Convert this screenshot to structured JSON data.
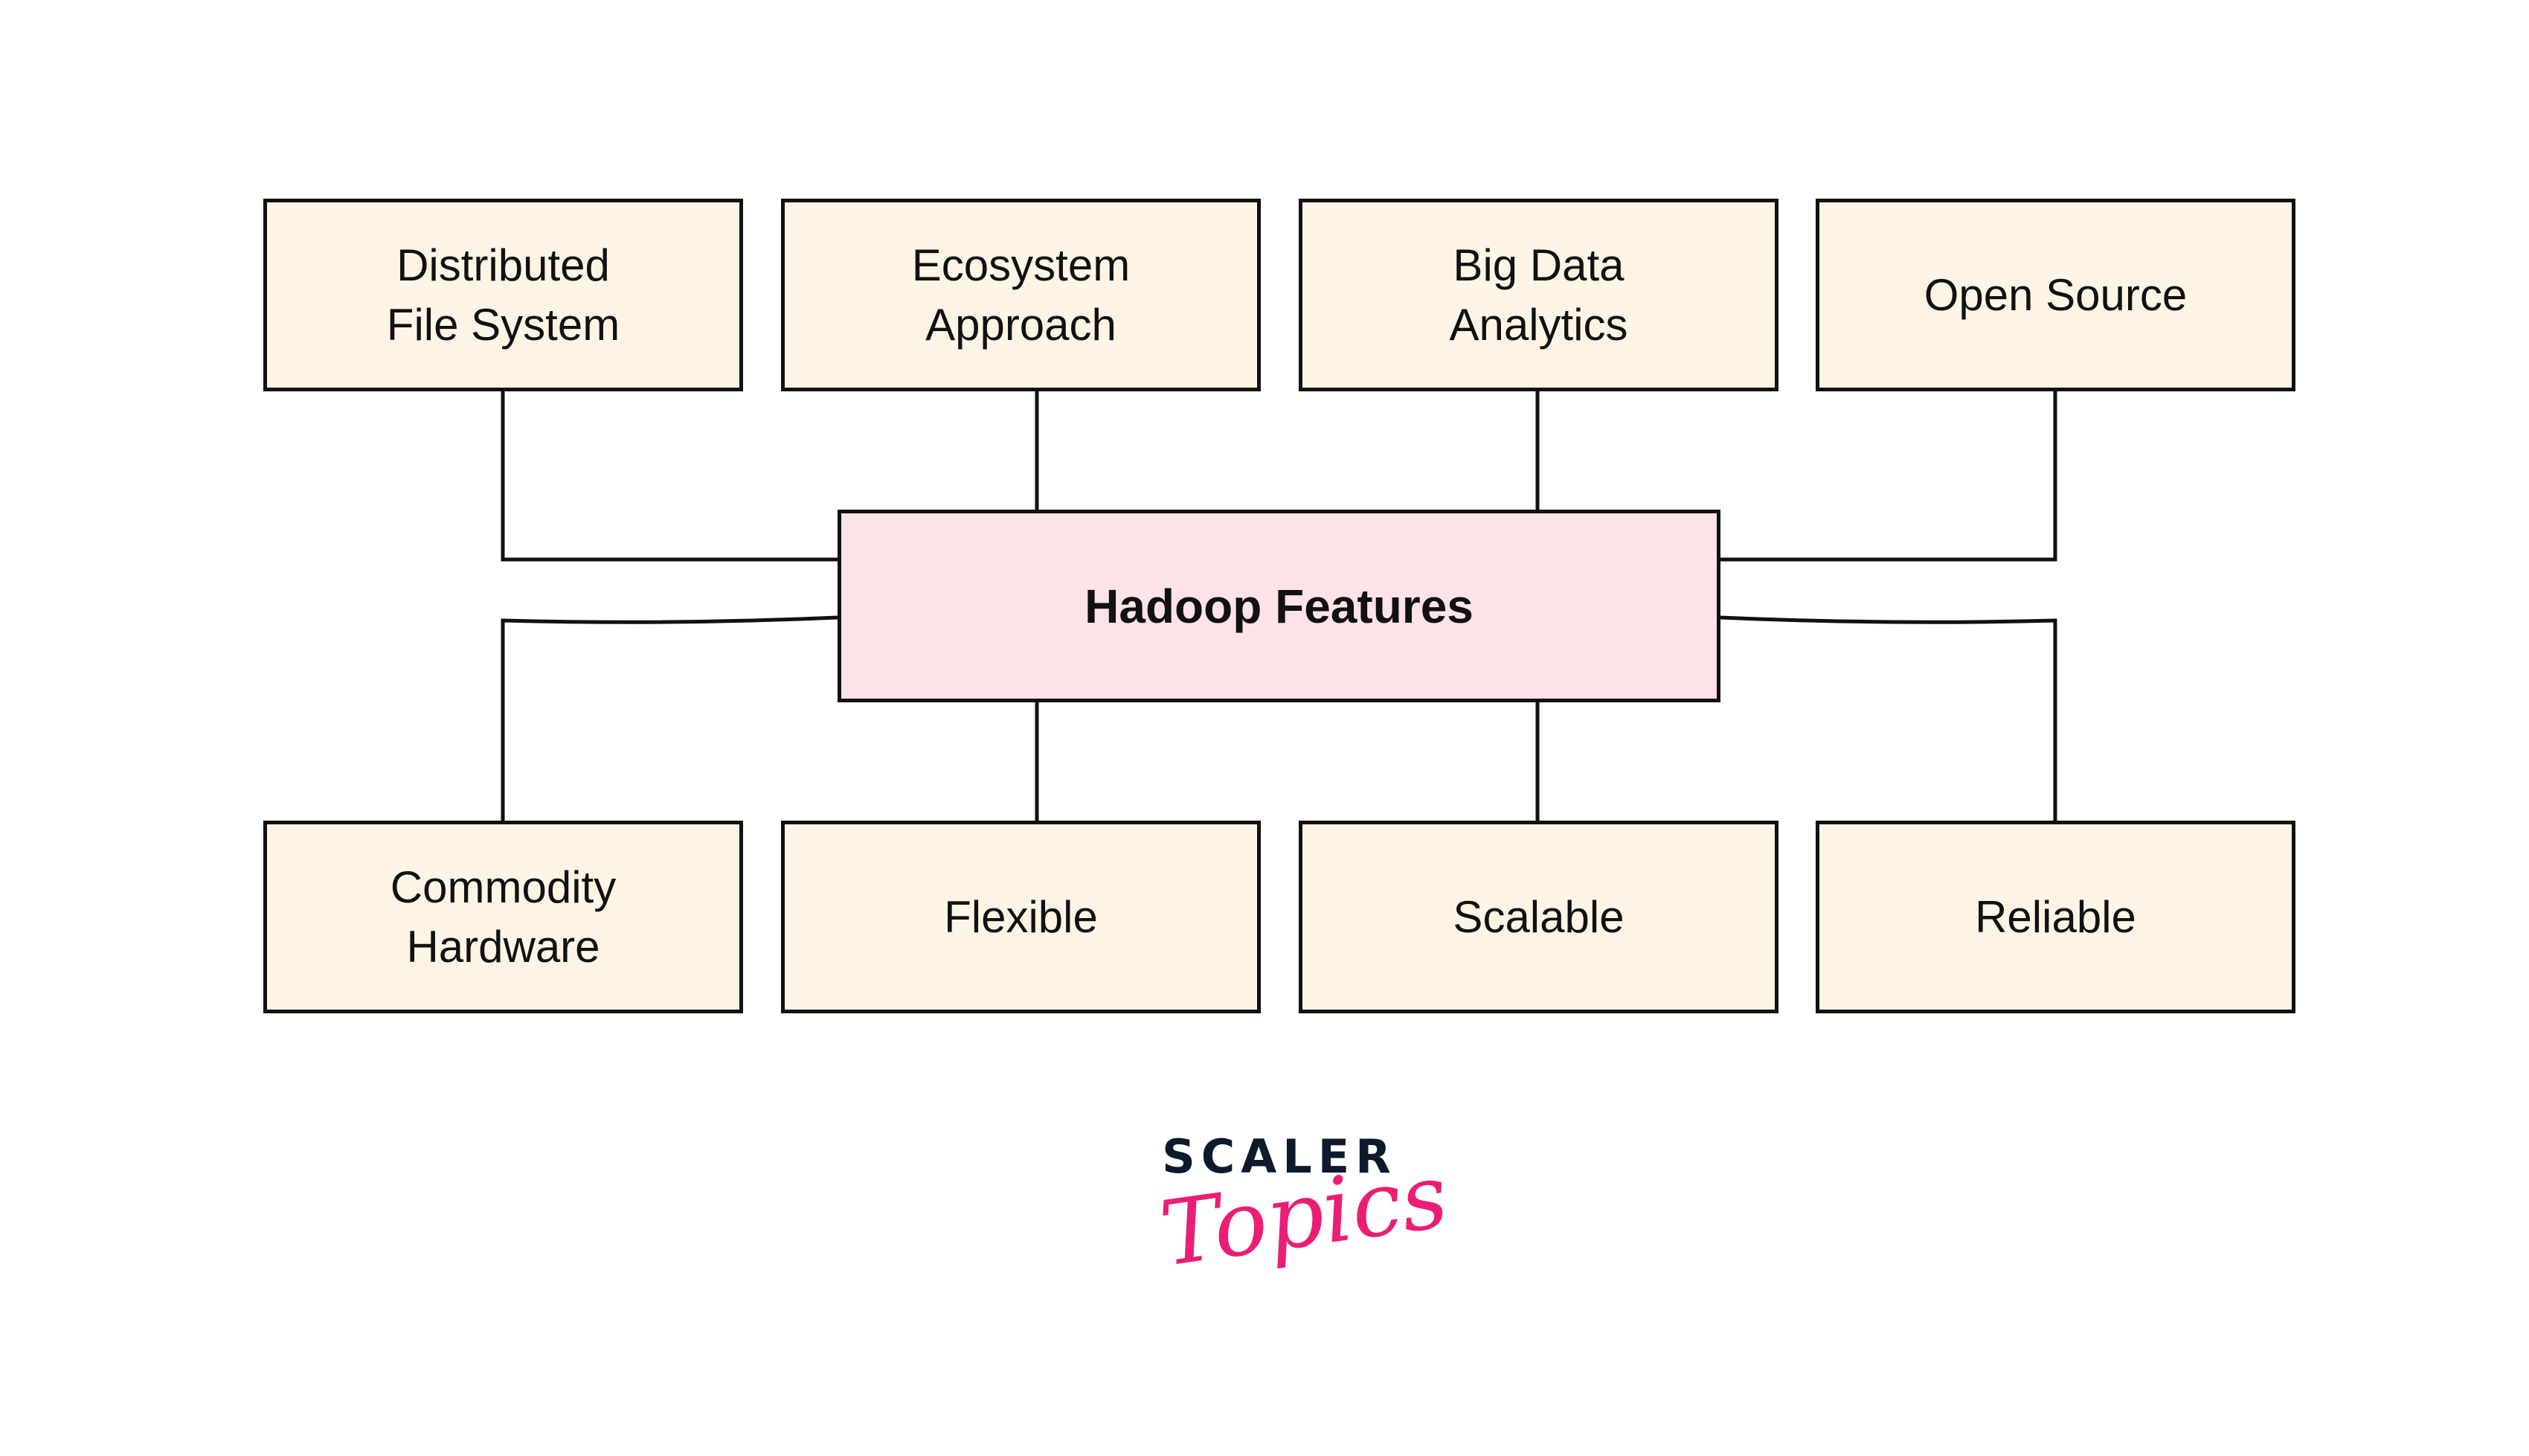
{
  "diagram": {
    "center": {
      "label": "Hadoop Features"
    },
    "top_row": [
      {
        "label": "Distributed\nFile System"
      },
      {
        "label": "Ecosystem\nApproach"
      },
      {
        "label": "Big Data\nAnalytics"
      },
      {
        "label": "Open Source"
      }
    ],
    "bottom_row": [
      {
        "label": "Commodity\nHardware"
      },
      {
        "label": "Flexible"
      },
      {
        "label": "Scalable"
      },
      {
        "label": "Reliable"
      }
    ],
    "colors": {
      "feature_box_fill": "#fdf4e6",
      "center_box_fill": "#fde3e8",
      "stroke": "#111111"
    }
  },
  "logo": {
    "line1": "SCALER",
    "line2": "Topics",
    "line1_color": "#0d1a2b",
    "line2_color": "#e91e74"
  }
}
